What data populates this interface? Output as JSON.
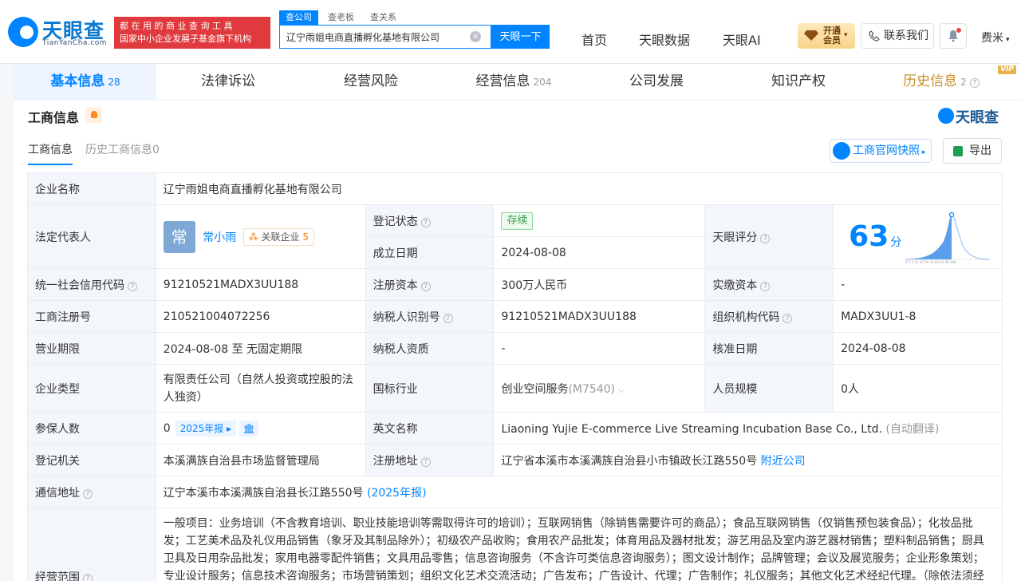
{
  "header": {
    "logo_cn": "天眼查",
    "logo_en": "TianYanCha.com",
    "slogan_line1": "都 在 用 的 商 业 查 询 工 具",
    "slogan_line2": "国家中小企业发展子基金旗下机构",
    "search_tabs": [
      "查公司",
      "查老板",
      "查关系"
    ],
    "search_value": "辽宁雨姐电商直播孵化基地有限公司",
    "search_button": "天眼一下",
    "nav": [
      "首页",
      "天眼数据",
      "天眼AI"
    ],
    "vip_line1": "开通",
    "vip_line2": "会员",
    "contact": "联系我们",
    "user": "费米"
  },
  "tabs": [
    {
      "label": "基本信息",
      "count": "28"
    },
    {
      "label": "法律诉讼",
      "count": ""
    },
    {
      "label": "经营风险",
      "count": ""
    },
    {
      "label": "经营信息",
      "count": "204"
    },
    {
      "label": "公司发展",
      "count": ""
    },
    {
      "label": "知识产权",
      "count": ""
    },
    {
      "label": "历史信息",
      "count": "2",
      "badge": "VIP"
    }
  ],
  "section": {
    "title": "工商信息",
    "right_logo": "天眼查",
    "subtabs": [
      "工商信息",
      "历史工商信息0"
    ],
    "gs_button": "工商官网快照",
    "export_button": "导出"
  },
  "info": {
    "company_name_label": "企业名称",
    "company_name": "辽宁雨姐电商直播孵化基地有限公司",
    "legal_rep_label": "法定代表人",
    "legal_rep_avatar": "常",
    "legal_rep_name": "常小雨",
    "related_label": "关联企业",
    "related_count": "5",
    "reg_status_label": "登记状态",
    "reg_status": "存续",
    "found_date_label": "成立日期",
    "found_date": "2024-08-08",
    "score_label": "天眼评分",
    "score": "63",
    "score_unit": "分",
    "credit_code_label": "统一社会信用代码",
    "credit_code": "91210521MADX3UU188",
    "reg_capital_label": "注册资本",
    "reg_capital": "300万人民币",
    "paid_capital_label": "实缴资本",
    "paid_capital": "-",
    "reg_no_label": "工商注册号",
    "reg_no": "210521004072256",
    "taxpayer_id_label": "纳税人识别号",
    "taxpayer_id": "91210521MADX3UU188",
    "org_code_label": "组织机构代码",
    "org_code": "MADX3UU1-8",
    "term_label": "营业期限",
    "term": "2024-08-08 至 无固定期限",
    "taxpayer_qual_label": "纳税人资质",
    "taxpayer_qual": "-",
    "approve_date_label": "核准日期",
    "approve_date": "2024-08-08",
    "type_label": "企业类型",
    "type": "有限责任公司（自然人投资或控股的法人独资）",
    "industry_label": "国标行业",
    "industry": "创业空间服务",
    "industry_code": "(M7540)",
    "staff_label": "人员规模",
    "staff": "0人",
    "insured_label": "参保人数",
    "insured": "0",
    "insured_report": "2025年报",
    "en_name_label": "英文名称",
    "en_name": "Liaoning Yujie E-commerce Live Streaming Incubation Base Co., Ltd.",
    "en_name_note": "(自动翻译)",
    "authority_label": "登记机关",
    "authority": "本溪满族自治县市场监督管理局",
    "address_label": "注册地址",
    "address": "辽宁省本溪市本溪满族自治县小市镇政长江路550号",
    "nearby": "附近公司",
    "mail_label": "通信地址",
    "mail": "辽宁本溪市本溪满族自治县长江路550号",
    "mail_report": "(2025年报)",
    "scope_label": "经营范围",
    "scope": "一般项目：业务培训（不含教育培训、职业技能培训等需取得许可的培训）；互联网销售（除销售需要许可的商品）；食品互联网销售（仅销售预包装食品）；化妆品批发；工艺美术品及礼仪用品销售（象牙及其制品除外）；初级农产品收购；食用农产品批发；体育用品及器材批发；游艺用品及室内游艺器材销售；塑料制品销售；厨具卫具及日用杂品批发；家用电器零配件销售；文具用品零售；信息咨询服务（不含许可类信息咨询服务）；图文设计制作；品牌管理；会议及展览服务；企业形象策划；专业设计服务；信息技术咨询服务；市场营销策划；组织文化艺术交流活动；广告发布；广告设计、代理；广告制作；礼仪服务；其他文化艺术经纪代理。（除依法须经"
  },
  "colors": {
    "accent": "#0084ff",
    "label_bg": "#f3f6fb",
    "slogan_bg": "#e03a3e",
    "status_green": "#2f9e44"
  }
}
